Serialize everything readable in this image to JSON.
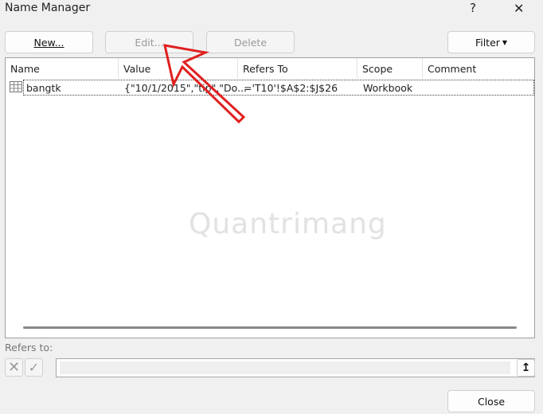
{
  "window": {
    "title": "Name Manager",
    "help": "?",
    "close": "✕"
  },
  "toolbar": {
    "new_label": "New...",
    "edit_label": "Edit...",
    "delete_label": "Delete",
    "filter_label": "Filter"
  },
  "columns": [
    "Name",
    "Value",
    "Refers To",
    "Scope",
    "Comment"
  ],
  "rows": [
    {
      "name": "bangtk",
      "value": "{\"10/1/2015\",\"tip\",\"Do...",
      "refers_to": "='T10'!$A$2:$J$26",
      "scope": "Workbook",
      "comment": ""
    }
  ],
  "refers": {
    "label": "Refers to:",
    "value": ""
  },
  "footer": {
    "close_label": "Close"
  },
  "watermark": "Quantrimang",
  "colors": {
    "arrow": "#e02020"
  }
}
